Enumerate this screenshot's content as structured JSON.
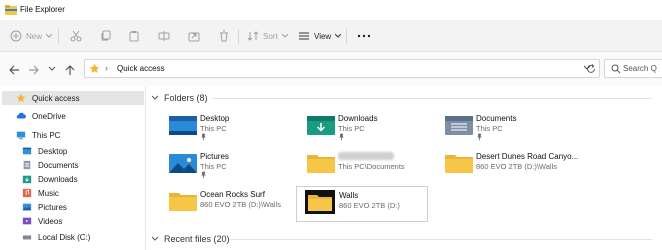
{
  "window": {
    "title": "File Explorer"
  },
  "toolbar": {
    "new_label": "New",
    "sort_label": "Sort",
    "view_label": "View"
  },
  "address": {
    "path": "Quick access",
    "search_placeholder": "Search Q"
  },
  "sidebar": {
    "items": [
      {
        "label": "Quick access",
        "icon": "star-icon",
        "selected": true
      },
      {
        "label": "OneDrive",
        "icon": "cloud-icon"
      },
      {
        "label": "This PC",
        "icon": "monitor-icon"
      },
      {
        "label": "Desktop",
        "icon": "desktop-folder-icon"
      },
      {
        "label": "Documents",
        "icon": "documents-icon"
      },
      {
        "label": "Downloads",
        "icon": "downloads-icon"
      },
      {
        "label": "Music",
        "icon": "music-icon"
      },
      {
        "label": "Pictures",
        "icon": "pictures-icon"
      },
      {
        "label": "Videos",
        "icon": "videos-icon"
      },
      {
        "label": "Local Disk (C:)",
        "icon": "drive-icon"
      }
    ]
  },
  "main": {
    "folders_header": "Folders (8)",
    "recent_header": "Recent files (20)",
    "folders": [
      {
        "name": "Desktop",
        "location": "This PC",
        "pinned": true,
        "icon": "desktop-folder-icon"
      },
      {
        "name": "Downloads",
        "location": "This PC",
        "pinned": true,
        "icon": "downloads-folder-icon"
      },
      {
        "name": "Documents",
        "location": "This PC",
        "pinned": true,
        "icon": "documents-folder-icon"
      },
      {
        "name": "Pictures",
        "location": "This PC",
        "pinned": true,
        "icon": "pictures-folder-icon"
      },
      {
        "name": "",
        "location": "This PC\\Documents",
        "pinned": false,
        "icon": "folder-icon"
      },
      {
        "name": "Desert Dunes Road Canyo...",
        "location": "860 EVO 2TB (D:)\\Walls",
        "pinned": false,
        "icon": "folder-icon"
      },
      {
        "name": "Ocean Rocks Surf",
        "location": "860 EVO 2TB (D:)\\Walls",
        "pinned": false,
        "icon": "folder-icon"
      },
      {
        "name": "Walls",
        "location": "860 EVO 2TB (D:)",
        "pinned": false,
        "icon": "folder-black-icon",
        "selected": true
      }
    ]
  },
  "colors": {
    "folder_yellow": "#f6c746",
    "accent_blue": "#2b7fd1",
    "teal": "#1a9b84"
  }
}
